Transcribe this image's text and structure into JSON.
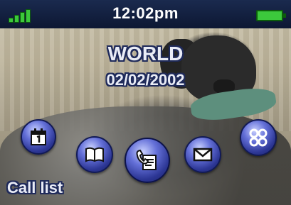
{
  "status_bar": {
    "time": "12:02pm",
    "signal_icon": "signal-strength-icon",
    "battery_icon": "battery-icon",
    "indicator_color": "#3cc83c"
  },
  "idle_screen": {
    "carrier": "WORLD",
    "date": "02/02/2002"
  },
  "menu": {
    "icons": [
      "calendar-icon",
      "phonebook-icon",
      "call-list-icon",
      "message-icon",
      "main-menu-icon"
    ],
    "selected": "call-list-icon",
    "orb_color": "#6470d8"
  },
  "softkey": {
    "left_label": "Call list"
  }
}
